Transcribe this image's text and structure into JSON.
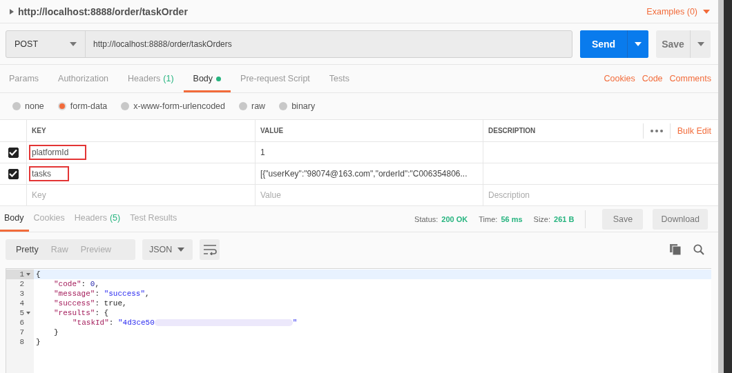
{
  "request_title": "http://localhost:8888/order/taskOrder",
  "examples": "Examples (0)",
  "method": "POST",
  "url": "http://localhost:8888/order/taskOrders",
  "send_button": "Send",
  "save_button": "Save",
  "request_tabs": [
    {
      "label": "Params",
      "selected": false
    },
    {
      "label": "Authorization",
      "selected": false
    },
    {
      "label": "Headers",
      "count": "(1)",
      "selected": false
    },
    {
      "label": "Body",
      "dot": true,
      "selected": true
    },
    {
      "label": "Pre-request Script",
      "selected": false
    },
    {
      "label": "Tests",
      "selected": false
    }
  ],
  "request_links": [
    "Cookies",
    "Code",
    "Comments"
  ],
  "body_types": [
    {
      "label": "none",
      "selected": false
    },
    {
      "label": "form-data",
      "selected": true
    },
    {
      "label": "x-www-form-urlencoded",
      "selected": false
    },
    {
      "label": "raw",
      "selected": false
    },
    {
      "label": "binary",
      "selected": false
    }
  ],
  "table": {
    "columns": [
      "KEY",
      "VALUE",
      "DESCRIPTION"
    ],
    "bulk_edit": "Bulk Edit",
    "rows": [
      {
        "checked": true,
        "key": "platformId",
        "value": "1",
        "highlighted": true
      },
      {
        "checked": true,
        "key": "tasks",
        "value": "[{\"userKey\":\"98074@163.com\",\"orderId\":\"C006354806...",
        "highlighted": true
      }
    ],
    "empty_row": [
      {
        "placeholder": "Key"
      },
      {
        "placeholder": "Value"
      },
      {
        "placeholder": "Description"
      }
    ]
  },
  "response_tabs": [
    {
      "label": "Body",
      "selected": true
    },
    {
      "label": "Cookies",
      "selected": false
    },
    {
      "label": "Headers",
      "count": "(5)",
      "selected": false
    },
    {
      "label": "Test Results",
      "selected": false
    }
  ],
  "response_meta": [
    {
      "label": "Status:",
      "value": "200 OK"
    },
    {
      "label": "Time:",
      "value": "56 ms"
    },
    {
      "label": "Size:",
      "value": "261 B"
    }
  ],
  "response_buttons": [
    "Save",
    "Download"
  ],
  "view_modes": [
    {
      "label": "Pretty",
      "selected": true
    },
    {
      "label": "Raw",
      "selected": false
    },
    {
      "label": "Preview",
      "selected": false
    }
  ],
  "format": "JSON",
  "code_lines": [
    {
      "number": "1",
      "foldable": true,
      "selected": true,
      "tokens": [
        {
          "kind": "punct",
          "text": "{"
        }
      ]
    },
    {
      "number": "2",
      "foldable": false,
      "selected": false,
      "tokens": [
        {
          "kind": "indent1"
        },
        {
          "kind": "key",
          "text": "\"code\""
        },
        {
          "kind": "punct",
          "text": ": "
        },
        {
          "kind": "number",
          "text": "0"
        },
        {
          "kind": "punct",
          "text": ","
        }
      ]
    },
    {
      "number": "3",
      "foldable": false,
      "selected": false,
      "tokens": [
        {
          "kind": "indent1"
        },
        {
          "kind": "key",
          "text": "\"message\""
        },
        {
          "kind": "punct",
          "text": ": "
        },
        {
          "kind": "string",
          "text": "\"success\""
        },
        {
          "kind": "punct",
          "text": ","
        }
      ]
    },
    {
      "number": "4",
      "foldable": false,
      "selected": false,
      "tokens": [
        {
          "kind": "indent1"
        },
        {
          "kind": "key",
          "text": "\"success\""
        },
        {
          "kind": "punct",
          "text": ": true,"
        }
      ]
    },
    {
      "number": "5",
      "foldable": true,
      "selected": false,
      "tokens": [
        {
          "kind": "indent1"
        },
        {
          "kind": "key",
          "text": "\"results\""
        },
        {
          "kind": "punct",
          "text": ": {"
        }
      ]
    },
    {
      "number": "6",
      "foldable": false,
      "selected": false,
      "tokens": [
        {
          "kind": "indent2"
        },
        {
          "kind": "key",
          "text": "\"taskId\""
        },
        {
          "kind": "punct",
          "text": ": "
        },
        {
          "kind": "string",
          "text": "\"4d3ce50"
        },
        {
          "kind": "redacted"
        },
        {
          "kind": "string",
          "text": "\""
        }
      ]
    },
    {
      "number": "7",
      "foldable": false,
      "selected": false,
      "tokens": [
        {
          "kind": "indent1"
        },
        {
          "kind": "punct",
          "text": "}"
        }
      ]
    },
    {
      "number": "8",
      "foldable": false,
      "selected": false,
      "tokens": [
        {
          "kind": "punct",
          "text": "}"
        }
      ]
    }
  ]
}
